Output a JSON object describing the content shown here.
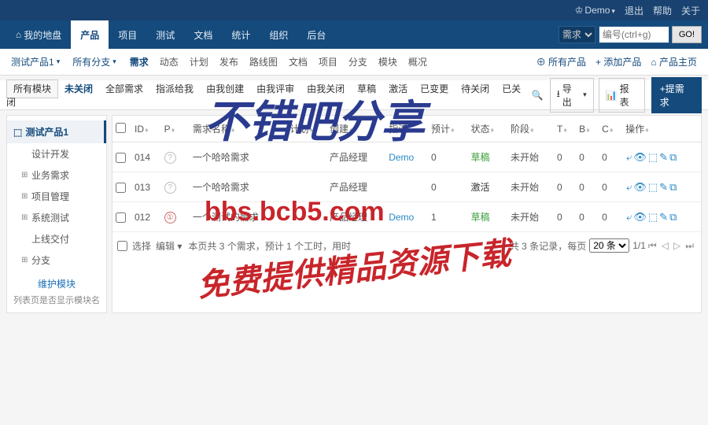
{
  "userbar": {
    "user": "Demo",
    "logout": "退出",
    "help": "帮助",
    "about": "关于"
  },
  "mainnav": {
    "items": [
      "我的地盘",
      "产品",
      "项目",
      "测试",
      "文档",
      "统计",
      "组织",
      "后台"
    ],
    "active": 1,
    "searchSel": "需求",
    "searchPh": "编号(ctrl+g)",
    "go": "GO!"
  },
  "subnav": {
    "product": "测试产品1",
    "branch": "所有分支",
    "items": [
      "需求",
      "动态",
      "计划",
      "发布",
      "路线图",
      "文档",
      "项目",
      "分支",
      "模块",
      "概况"
    ],
    "active": 0,
    "right": [
      {
        "icon": "⊕",
        "label": "所有产品"
      },
      {
        "icon": "+",
        "label": "添加产品"
      },
      {
        "icon": "⌂",
        "label": "产品主页"
      }
    ]
  },
  "filter": {
    "items": [
      "所有模块",
      "未关闭",
      "全部需求",
      "指派给我",
      "由我创建",
      "由我评审",
      "由我关闭",
      "草稿",
      "激活",
      "已变更",
      "待关闭",
      "已关闭"
    ],
    "boxed": 0,
    "active": 1,
    "export": "导出",
    "report": "报表",
    "create": "+提需求"
  },
  "side": {
    "title": "测试产品1",
    "nodes": [
      {
        "exp": "",
        "label": "设计开发"
      },
      {
        "exp": "⊞",
        "label": "业务需求"
      },
      {
        "exp": "⊞",
        "label": "项目管理"
      },
      {
        "exp": "⊞",
        "label": "系统测试"
      },
      {
        "exp": "",
        "label": "上线交付"
      },
      {
        "exp": "⊞",
        "label": "分支"
      }
    ],
    "maint": "维护模块",
    "hint": "列表页是否显示模块名"
  },
  "table": {
    "cols": [
      "ID",
      "P",
      "需求名称",
      "计划",
      "创建",
      "指派",
      "预计",
      "状态",
      "阶段",
      "T",
      "B",
      "C",
      "操作"
    ],
    "rows": [
      {
        "id": "014",
        "p": "?",
        "pcls": "gray",
        "name": "一个哈哈需求",
        "plan": "",
        "creator": "产品经理",
        "assign": "Demo",
        "est": "0",
        "status": "草稿",
        "statusCls": "status-draft",
        "stage": "未开始",
        "t": "0",
        "b": "0",
        "c": "0"
      },
      {
        "id": "013",
        "p": "?",
        "pcls": "gray",
        "name": "一个哈哈需求",
        "plan": "",
        "creator": "产品经理",
        "assign": "",
        "est": "0",
        "status": "激活",
        "statusCls": "status-act",
        "stage": "未开始",
        "t": "0",
        "b": "0",
        "c": "0"
      },
      {
        "id": "012",
        "p": "①",
        "pcls": "",
        "name": "一个测试的需求",
        "plan": "",
        "creator": "产品经理",
        "assign": "Demo",
        "est": "1",
        "status": "草稿",
        "statusCls": "status-draft",
        "stage": "未开始",
        "t": "0",
        "b": "0",
        "c": "0"
      }
    ],
    "footer": {
      "selectAll": "选择",
      "edit": "编辑",
      "summary": "本页共 3 个需求，预计 1 个工时，用时",
      "total": "共 3 条记录",
      "perpageLabel": "每页",
      "perpage": "20 条",
      "page": "1/1"
    }
  },
  "watermark": {
    "l1": "不错吧分享",
    "l2": "bbs.bcb5.com",
    "l3": "免费提供精品资源下载"
  }
}
